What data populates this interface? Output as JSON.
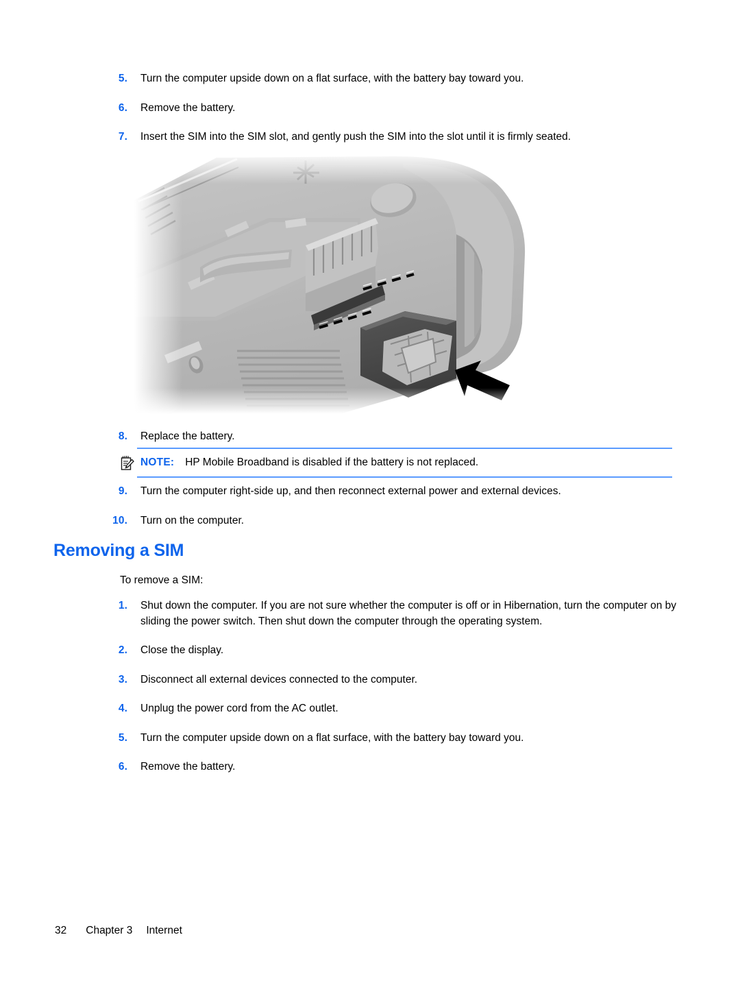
{
  "steps_insert": [
    {
      "num": "5.",
      "text": "Turn the computer upside down on a flat surface, with the battery bay toward you."
    },
    {
      "num": "6.",
      "text": "Remove the battery."
    },
    {
      "num": "7.",
      "text": "Insert the SIM into the SIM slot, and gently push the SIM into the slot until it is firmly seated."
    }
  ],
  "steps_insert_after": [
    {
      "num": "8.",
      "text": "Replace the battery."
    }
  ],
  "steps_insert_tail": [
    {
      "num": "9.",
      "text": "Turn the computer right-side up, and then reconnect external power and external devices."
    },
    {
      "num": "10.",
      "text": "Turn on the computer."
    }
  ],
  "note": {
    "icon": "note-pad-pencil-icon",
    "label": "NOTE:",
    "text": "HP Mobile Broadband is disabled if the battery is not replaced.",
    "rule_color": "#5b9bff",
    "label_color": "#0e64ec"
  },
  "heading": {
    "title": "Removing a SIM",
    "color": "#0e64ec"
  },
  "intro": "To remove a SIM:",
  "steps_remove": [
    {
      "num": "1.",
      "text": "Shut down the computer. If you are not sure whether the computer is off or in Hibernation, turn the computer on by sliding the power switch. Then shut down the computer through the operating system."
    },
    {
      "num": "2.",
      "text": "Close the display."
    },
    {
      "num": "3.",
      "text": "Disconnect all external devices connected to the computer."
    },
    {
      "num": "4.",
      "text": "Unplug the power cord from the AC outlet."
    },
    {
      "num": "5.",
      "text": "Turn the computer upside down on a flat surface, with the battery bay toward you."
    },
    {
      "num": "6.",
      "text": "Remove the battery."
    }
  ],
  "figure": {
    "alt": "Grayscale illustration of a notebook computer turned upside down with a SIM card being inserted into the SIM slot inside the battery bay; a black arrow indicates the push direction.",
    "arrow_direction": "up-left",
    "sim_color": "#4a4a4a",
    "chassis_color": "#b8b8b8"
  },
  "footer": {
    "page_number": "32",
    "chapter": "Chapter 3",
    "section": "Internet"
  }
}
